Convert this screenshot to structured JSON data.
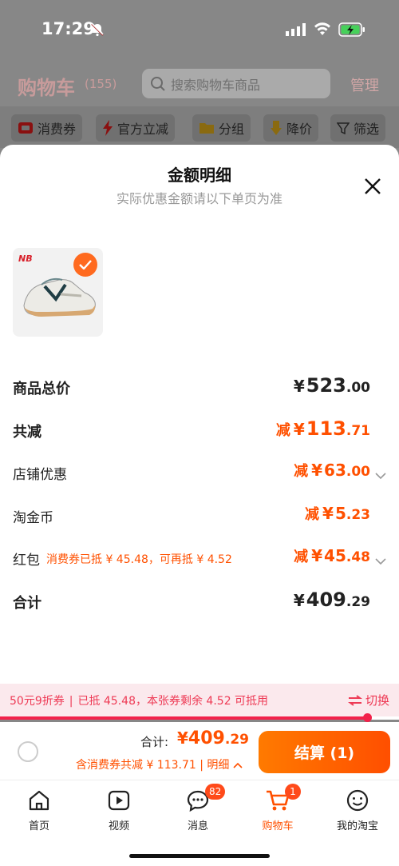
{
  "status_bar": {
    "time": "17:29"
  },
  "header": {
    "title": "购物车",
    "count": "(155)",
    "search_placeholder": "搜索购物车商品",
    "manage": "管理"
  },
  "filters": [
    {
      "label": "消费券",
      "icon": "coupon-icon"
    },
    {
      "label": "官方立减",
      "icon": "lightning-icon"
    },
    {
      "label": "分组",
      "icon": "folder-icon"
    },
    {
      "label": "降价",
      "icon": "price-drop-icon"
    },
    {
      "label": "筛选",
      "icon": "filter-icon"
    }
  ],
  "sheet": {
    "title": "金额明细",
    "subtitle": "实际优惠金额请以下单页为准",
    "product_brand": "NB",
    "rows": {
      "total_price": {
        "label": "商品总价",
        "yen": "¥",
        "int": "523",
        "dec": ".00"
      },
      "total_reduction": {
        "label": "共减",
        "prefix": "减",
        "yen": "¥",
        "int": "113",
        "dec": ".71"
      },
      "store_discount": {
        "label": "店铺优惠",
        "prefix": "减",
        "yen": "¥",
        "int": "63",
        "dec": ".00"
      },
      "taojinbi": {
        "label": "淘金币",
        "prefix": "减",
        "yen": "¥",
        "int": "5",
        "dec": ".23"
      },
      "red_packet": {
        "label": "红包",
        "note": "消费券已抵 ¥ 45.48，可再抵 ¥ 4.52",
        "prefix": "减",
        "yen": "¥",
        "int": "45",
        "dec": ".48"
      },
      "subtotal": {
        "label": "合计",
        "yen": "¥",
        "int": "409",
        "dec": ".29"
      }
    }
  },
  "coupon_bar": {
    "name": "50元9折券",
    "sep": "|",
    "text": "已抵 45.48，本张券剩余 4.52 可抵用",
    "switch": "切换",
    "progress": 0.92
  },
  "checkout": {
    "total_label": "合计:",
    "yen": "¥",
    "int": " 409",
    "dec": ".29",
    "discount_text": "含消费券共减 ¥ 113.71 | 明细",
    "submit": "结算 (1)"
  },
  "tabbar": [
    {
      "label": "首页",
      "icon": "home-icon"
    },
    {
      "label": "视频",
      "icon": "video-icon"
    },
    {
      "label": "消息",
      "icon": "message-icon",
      "badge": "82"
    },
    {
      "label": "购物车",
      "icon": "cart-icon",
      "badge": "1"
    },
    {
      "label": "我的淘宝",
      "icon": "profile-icon"
    }
  ],
  "colors": {
    "accent": "#ff5000",
    "coupon_red": "#ee3a55",
    "checkout_orange": "#ff6a00"
  }
}
